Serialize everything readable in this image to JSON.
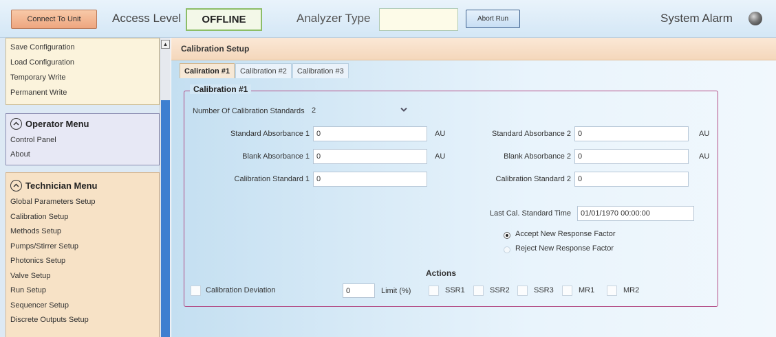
{
  "toolbar": {
    "connect_label": "Connect To Unit",
    "access_label": "Access Level",
    "access_value": "OFFLINE",
    "analyzer_label": "Analyzer Type",
    "analyzer_value": "",
    "abort_label": "Abort Run",
    "alarm_label": "System Alarm",
    "alarm_icon": "alarm-indicator-icon"
  },
  "sidebar": {
    "config_items": [
      "Save Configuration",
      "Load Configuration",
      "Temporary Write",
      "Permanent Write"
    ],
    "operator_menu": {
      "title": "Operator Menu",
      "items": [
        "Control Panel",
        "About"
      ]
    },
    "technician_menu": {
      "title": "Technician Menu",
      "items": [
        "Global Parameters Setup",
        "Calibration Setup",
        "Methods Setup",
        "Pumps/Stirrer Setup",
        "Photonics Setup",
        "Valve Setup",
        "Run Setup",
        "Sequencer Setup",
        "Discrete Outputs Setup"
      ]
    }
  },
  "main": {
    "title": "Calibration Setup",
    "tabs": [
      "Caliration #1",
      "Calibration #2",
      "Calibration #3"
    ],
    "group_title": "Calibration #1",
    "num_standards_label": "Number Of Calibration Standards",
    "num_standards_value": "2",
    "std_abs_1_label": "Standard Absorbance 1",
    "std_abs_1_value": "0",
    "std_abs_1_unit": "AU",
    "blank_abs_1_label": "Blank Absorbance 1",
    "blank_abs_1_value": "0",
    "blank_abs_1_unit": "AU",
    "cal_std_1_label": "Calibration Standard 1",
    "cal_std_1_value": "0",
    "std_abs_2_label": "Standard Absorbance 2",
    "std_abs_2_value": "0",
    "std_abs_2_unit": "AU",
    "blank_abs_2_label": "Blank Absorbance 2",
    "blank_abs_2_value": "0",
    "blank_abs_2_unit": "AU",
    "cal_std_2_label": "Calibration Standard 2",
    "cal_std_2_value": "0",
    "last_cal_label": "Last Cal. Standard Time",
    "last_cal_value": "01/01/1970 00:00:00",
    "accept_label": "Accept New Response Factor",
    "accept_selected": true,
    "reject_label": "Reject New Response Factor",
    "actions_label": "Actions",
    "deviation_label": "Calibration Deviation",
    "limit_value": "0",
    "limit_label": "Limit (%)",
    "checkboxes": [
      "SSR1",
      "SSR2",
      "SSR3",
      "MR1",
      "MR2"
    ]
  }
}
